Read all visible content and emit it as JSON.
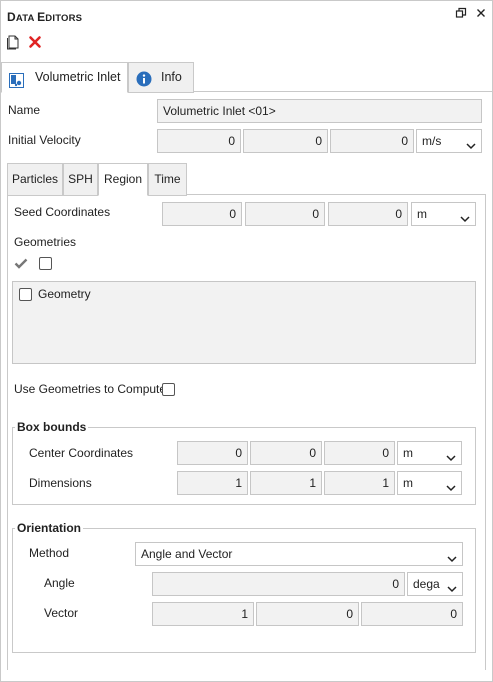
{
  "window": {
    "title_first": "D",
    "title_rest": "ATA ",
    "title_second_first": "E",
    "title_second_rest": "DITORS",
    "restore_icon": "restore-icon",
    "close_icon": "close-icon"
  },
  "toolbar": {
    "new_icon": "document-icon",
    "delete_icon": "delete-red-x-icon"
  },
  "main_tabs": [
    {
      "label": "Volumetric Inlet",
      "icon": "inlet-icon",
      "active": true
    },
    {
      "label": "Info",
      "icon": "info-icon",
      "active": false
    }
  ],
  "form": {
    "name_label": "Name",
    "name_value": "Volumetric Inlet <01>",
    "initial_velocity_label": "Initial Velocity",
    "initial_velocity": [
      "0",
      "0",
      "0"
    ],
    "initial_velocity_unit": "m/s"
  },
  "sub_tabs": [
    {
      "label": "Particles"
    },
    {
      "label": "SPH"
    },
    {
      "label": "Region"
    },
    {
      "label": "Time"
    }
  ],
  "region": {
    "seed_label": "Seed Coordinates",
    "seed_values": [
      "0",
      "0",
      "0"
    ],
    "seed_unit": "m",
    "geometries_label": "Geometries",
    "geometry_item": "Geometry",
    "use_geometries_label": "Use Geometries to Compute",
    "box_bounds": {
      "title": "Box bounds",
      "center_label": "Center Coordinates",
      "center_values": [
        "0",
        "0",
        "0"
      ],
      "center_unit": "m",
      "dimensions_label": "Dimensions",
      "dimensions_values": [
        "1",
        "1",
        "1"
      ],
      "dimensions_unit": "m"
    },
    "orientation": {
      "title": "Orientation",
      "method_label": "Method",
      "method_value": "Angle and Vector",
      "angle_label": "Angle",
      "angle_value": "0",
      "angle_unit": "dega",
      "vector_label": "Vector",
      "vector_values": [
        "1",
        "0",
        "0"
      ]
    }
  },
  "colors": {
    "accent_blue": "#2a6ebb",
    "delete_red": "#e02424",
    "field_bg": "#f2f2f2",
    "border": "#c6c6c6"
  }
}
